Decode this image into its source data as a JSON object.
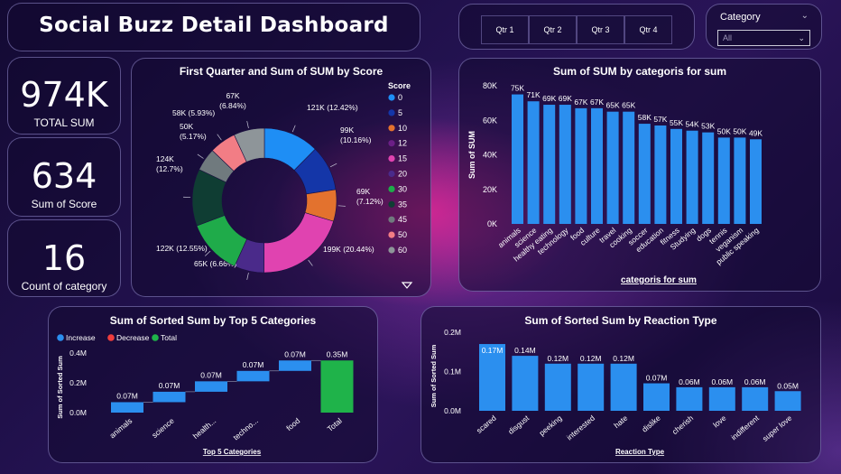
{
  "header": {
    "title": "Social Buzz Detail Dashboard"
  },
  "quarters": [
    "Qtr 1",
    "Qtr 2",
    "Qtr 3",
    "Qtr 4"
  ],
  "category_filter": {
    "label": "Category",
    "value": "All"
  },
  "kpis": [
    {
      "value": "974K",
      "label": "TOTAL SUM"
    },
    {
      "value": "634",
      "label": "Sum of Score"
    },
    {
      "value": "16",
      "label": "Count of category"
    }
  ],
  "colors": {
    "bar": "#2b8fef",
    "increase": "#2b8fef",
    "decrease": "#f03d3d",
    "total": "#1fb34a"
  },
  "chart_data": [
    {
      "type": "pie",
      "title": "First Quarter and Sum of SUM by Score",
      "legend_title": "Score",
      "legend_position": "right",
      "slices": [
        {
          "name": "0",
          "value": 121,
          "label": "121K (12.42%)",
          "color": "#1e8ef5"
        },
        {
          "name": "5",
          "value": 99,
          "label": "99K (10.16%)",
          "color": "#1436a8"
        },
        {
          "name": "10",
          "value": 69,
          "label": "69K (7.12%)",
          "color": "#e3722e"
        },
        {
          "name": "12",
          "value": 0,
          "label": "",
          "color": "#6b1f86"
        },
        {
          "name": "15",
          "value": 199,
          "label": "199K (20.44%)",
          "color": "#e043b0"
        },
        {
          "name": "20",
          "value": 65,
          "label": "65K (6.66%)",
          "color": "#4a2a8a"
        },
        {
          "name": "30",
          "value": 122,
          "label": "122K (12.55%)",
          "color": "#1fab4a"
        },
        {
          "name": "35",
          "value": 124,
          "label": "124K (12.7%)",
          "color": "#0f3d33"
        },
        {
          "name": "45",
          "value": 50,
          "label": "50K (5.17%)",
          "color": "#707a7e"
        },
        {
          "name": "50",
          "value": 58,
          "label": "58K (5.93%)",
          "color": "#f27d85"
        },
        {
          "name": "60",
          "value": 67,
          "label": "67K (6.84%)",
          "color": "#8e9599"
        }
      ]
    },
    {
      "type": "bar",
      "title": "Sum of SUM by categoris for sum",
      "xlabel": "categoris for sum",
      "ylabel": "Sum of SUM",
      "ylim": [
        0,
        80000
      ],
      "yticks": [
        "0K",
        "20K",
        "40K",
        "60K",
        "80K"
      ],
      "categories": [
        "animals",
        "science",
        "healthy eating",
        "technology",
        "food",
        "culture",
        "travel",
        "cooking",
        "soccer",
        "education",
        "fitness",
        "Studying",
        "dogs",
        "tennis",
        "veganism",
        "public speaking"
      ],
      "values": [
        75000,
        71000,
        69000,
        69000,
        67000,
        67000,
        65000,
        65000,
        58000,
        57000,
        55000,
        54000,
        53000,
        50000,
        50000,
        49000
      ],
      "labels": [
        "75K",
        "71K",
        "69K",
        "69K",
        "67K",
        "67K",
        "65K",
        "65K",
        "58K",
        "57K",
        "55K",
        "54K",
        "53K",
        "50K",
        "50K",
        "49K"
      ],
      "grid": false
    },
    {
      "type": "waterfall",
      "title": "Sum of Sorted Sum by Top 5 Categories",
      "xlabel": "Top 5 Categories",
      "ylabel": "Sum of Sorted Sum",
      "ylim": [
        0,
        0.4
      ],
      "yticks": [
        "0.0M",
        "0.2M",
        "0.4M"
      ],
      "legend": [
        "Increase",
        "Decrease",
        "Total"
      ],
      "categories": [
        "animals",
        "science",
        "health...",
        "techno...",
        "food",
        "Total"
      ],
      "values": [
        0.07,
        0.07,
        0.07,
        0.07,
        0.07,
        0.35
      ],
      "labels": [
        "0.07M",
        "0.07M",
        "0.07M",
        "0.07M",
        "0.07M",
        "0.35M"
      ]
    },
    {
      "type": "bar",
      "title": "Sum of Sorted Sum by Reaction Type",
      "xlabel": "Reaction Type",
      "ylabel": "Sum of Sorted Sum",
      "ylim": [
        0,
        0.2
      ],
      "yticks": [
        "0.0M",
        "0.1M",
        "0.2M"
      ],
      "categories": [
        "scared",
        "disgust",
        "peeking",
        "interested",
        "hate",
        "dislike",
        "cherish",
        "love",
        "indifferent",
        "super love"
      ],
      "values": [
        0.17,
        0.14,
        0.12,
        0.12,
        0.12,
        0.07,
        0.06,
        0.06,
        0.06,
        0.05
      ],
      "labels": [
        "0.17M",
        "0.14M",
        "0.12M",
        "0.12M",
        "0.12M",
        "0.07M",
        "0.06M",
        "0.06M",
        "0.06M",
        "0.05M"
      ],
      "grid": false
    }
  ]
}
